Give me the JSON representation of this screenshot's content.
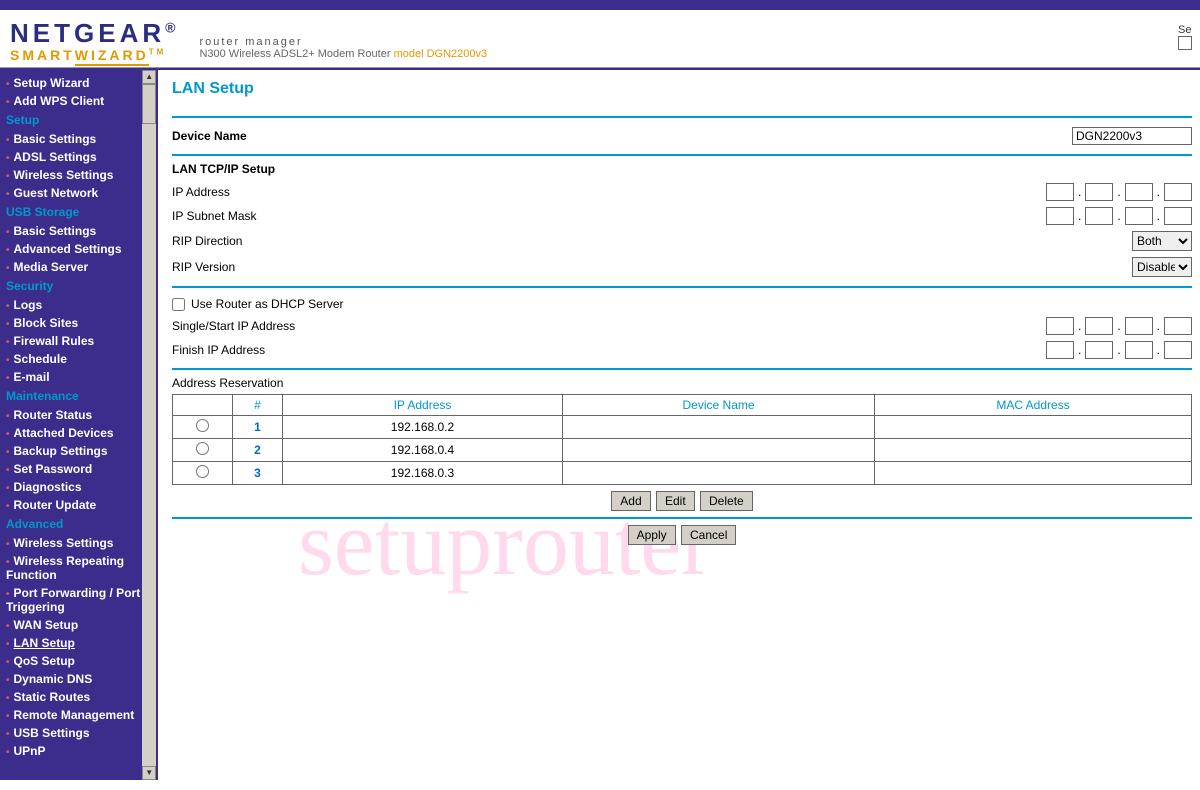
{
  "header": {
    "brand": "NETGEAR",
    "subbrand_smart": "SMART",
    "subbrand_wizard": "WIZARD",
    "tm": "TM",
    "title": "router manager",
    "subtitle": "N300 Wireless ADSL2+ Modem Router",
    "model_label": "model DGN2200v3",
    "right_label": "Se"
  },
  "sidebar": {
    "top_items": [
      "Setup Wizard",
      "Add WPS Client"
    ],
    "sections": [
      {
        "title": "Setup",
        "items": [
          "Basic Settings",
          "ADSL Settings",
          "Wireless Settings",
          "Guest Network"
        ]
      },
      {
        "title": "USB Storage",
        "items": [
          "Basic Settings",
          "Advanced Settings",
          "Media Server"
        ]
      },
      {
        "title": "Security",
        "items": [
          "Logs",
          "Block Sites",
          "Firewall Rules",
          "Schedule",
          "E-mail"
        ]
      },
      {
        "title": "Maintenance",
        "items": [
          "Router Status",
          "Attached Devices",
          "Backup Settings",
          "Set Password",
          "Diagnostics",
          "Router Update"
        ]
      },
      {
        "title": "Advanced",
        "items": [
          "Wireless Settings",
          "Wireless Repeating Function",
          "Port Forwarding / Port Triggering",
          "WAN Setup",
          "LAN Setup",
          "QoS Setup",
          "Dynamic DNS",
          "Static Routes",
          "Remote Management",
          "USB Settings",
          "UPnP"
        ]
      }
    ],
    "active_item": "LAN Setup"
  },
  "page": {
    "title": "LAN Setup",
    "device_name_label": "Device Name",
    "device_name_value": "DGN2200v3",
    "lan_section": "LAN TCP/IP Setup",
    "ip_address_label": "IP Address",
    "subnet_label": "IP Subnet Mask",
    "rip_dir_label": "RIP Direction",
    "rip_dir_value": "Both",
    "rip_ver_label": "RIP Version",
    "rip_ver_value": "Disable",
    "dhcp_checkbox_label": "Use Router as DHCP Server",
    "start_ip_label": "Single/Start IP Address",
    "finish_ip_label": "Finish IP Address",
    "reservation_title": "Address Reservation",
    "table": {
      "headers": [
        "",
        "#",
        "IP Address",
        "Device Name",
        "MAC Address"
      ],
      "rows": [
        {
          "idx": "1",
          "ip": "192.168.0.2",
          "name": "",
          "mac": ""
        },
        {
          "idx": "2",
          "ip": "192.168.0.4",
          "name": "",
          "mac": ""
        },
        {
          "idx": "3",
          "ip": "192.168.0.3",
          "name": "",
          "mac": ""
        }
      ]
    },
    "buttons": {
      "add": "Add",
      "edit": "Edit",
      "delete": "Delete",
      "apply": "Apply",
      "cancel": "Cancel"
    }
  },
  "watermark": "setuprouter"
}
